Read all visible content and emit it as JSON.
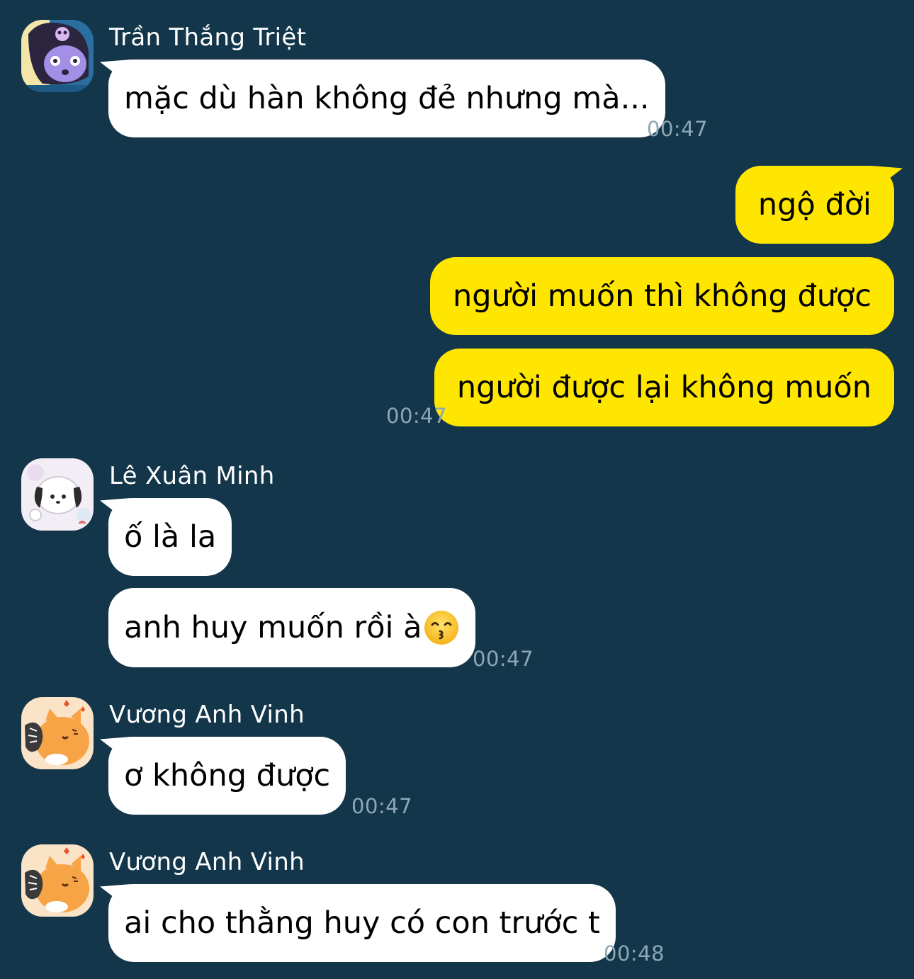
{
  "messages": [
    {
      "sender": "Trần Thắng Triệt",
      "text": "mặc dù hàn không đẻ nhưng mà...",
      "time": "00:47"
    },
    {
      "text": "ngộ đời"
    },
    {
      "text": "người muốn thì không được"
    },
    {
      "text": "người được lại không muốn",
      "time": "00:47"
    },
    {
      "sender": "Lê Xuân Minh",
      "text": "ố là la"
    },
    {
      "text": "anh huy muốn rồi à",
      "emoji": "kissing-face-smiling-eyes",
      "time": "00:47"
    },
    {
      "sender": "Vương Anh Vinh",
      "text": "ơ không được",
      "time": "00:47"
    },
    {
      "sender": "Vương Anh Vinh",
      "text": "ai cho thằng huy có con trước t",
      "time": "00:48"
    }
  ],
  "colors": {
    "background": "#14364a",
    "incoming_bubble": "#ffffff",
    "outgoing_bubble": "#ffe600",
    "timestamp": "#8ea7b5"
  }
}
